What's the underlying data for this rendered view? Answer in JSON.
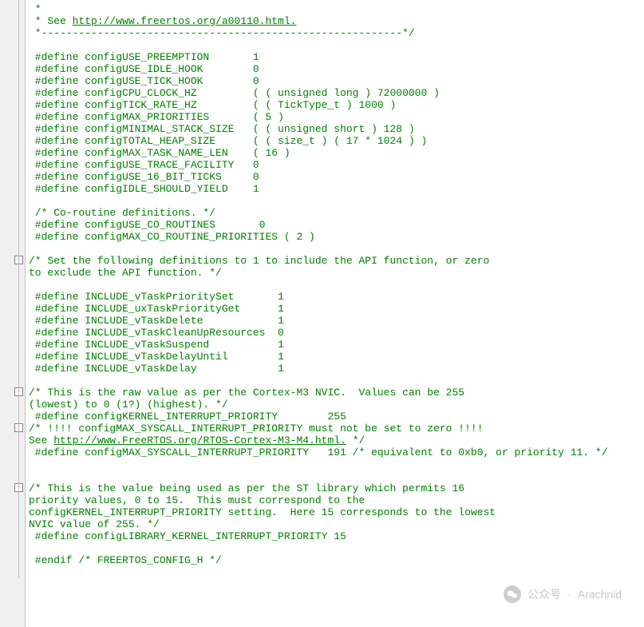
{
  "lines": [
    {
      "indent": " *",
      "text": ""
    },
    {
      "indent": " * See ",
      "link": "http://www.freertos.org/a00110.html.",
      "after": ""
    },
    {
      "indent": " *----------------------------------------------------------*/",
      "text": ""
    },
    {
      "indent": "",
      "text": ""
    },
    {
      "indent": " #define configUSE_PREEMPTION       1",
      "text": ""
    },
    {
      "indent": " #define configUSE_IDLE_HOOK        0",
      "text": ""
    },
    {
      "indent": " #define configUSE_TICK_HOOK        0",
      "text": ""
    },
    {
      "indent": " #define configCPU_CLOCK_HZ         ( ( unsigned long ) 72000000 )",
      "text": ""
    },
    {
      "indent": " #define configTICK_RATE_HZ         ( ( TickType_t ) 1000 )",
      "text": ""
    },
    {
      "indent": " #define configMAX_PRIORITIES       ( 5 )",
      "text": ""
    },
    {
      "indent": " #define configMINIMAL_STACK_SIZE   ( ( unsigned short ) 128 )",
      "text": ""
    },
    {
      "indent": " #define configTOTAL_HEAP_SIZE      ( ( size_t ) ( 17 * 1024 ) )",
      "text": ""
    },
    {
      "indent": " #define configMAX_TASK_NAME_LEN    ( 16 )",
      "text": ""
    },
    {
      "indent": " #define configUSE_TRACE_FACILITY   0",
      "text": ""
    },
    {
      "indent": " #define configUSE_16_BIT_TICKS     0",
      "text": ""
    },
    {
      "indent": " #define configIDLE_SHOULD_YIELD    1",
      "text": ""
    },
    {
      "indent": "",
      "text": ""
    },
    {
      "indent": " /* Co-routine definitions. */",
      "text": ""
    },
    {
      "indent": " #define configUSE_CO_ROUTINES       0",
      "text": ""
    },
    {
      "indent": " #define configMAX_CO_ROUTINE_PRIORITIES ( 2 )",
      "text": ""
    },
    {
      "indent": "",
      "text": ""
    },
    {
      "indent": "/* Set the following definitions to 1 to include the API function, or zero",
      "text": ""
    },
    {
      "indent": "to exclude the API function. */",
      "text": ""
    },
    {
      "indent": "",
      "text": ""
    },
    {
      "indent": " #define INCLUDE_vTaskPrioritySet       1",
      "text": ""
    },
    {
      "indent": " #define INCLUDE_uxTaskPriorityGet      1",
      "text": ""
    },
    {
      "indent": " #define INCLUDE_vTaskDelete            1",
      "text": ""
    },
    {
      "indent": " #define INCLUDE_vTaskCleanUpResources  0",
      "text": ""
    },
    {
      "indent": " #define INCLUDE_vTaskSuspend           1",
      "text": ""
    },
    {
      "indent": " #define INCLUDE_vTaskDelayUntil        1",
      "text": ""
    },
    {
      "indent": " #define INCLUDE_vTaskDelay             1",
      "text": ""
    },
    {
      "indent": "",
      "text": ""
    },
    {
      "indent": "/* This is the raw value as per the Cortex-M3 NVIC.  Values can be 255",
      "text": ""
    },
    {
      "indent": "(lowest) to 0 (1?) (highest). */",
      "text": ""
    },
    {
      "indent": " #define configKERNEL_INTERRUPT_PRIORITY        255",
      "text": ""
    },
    {
      "indent": "/* !!!! configMAX_SYSCALL_INTERRUPT_PRIORITY must not be set to zero !!!!",
      "text": ""
    },
    {
      "indent": "See ",
      "link": "http://www.FreeRTOS.org/RTOS-Cortex-M3-M4.html.",
      "after": " */"
    },
    {
      "indent": " #define configMAX_SYSCALL_INTERRUPT_PRIORITY   191 /* equivalent to 0xb0, or priority 11. */",
      "text": ""
    },
    {
      "indent": "",
      "text": ""
    },
    {
      "indent": "",
      "text": ""
    },
    {
      "indent": "/* This is the value being used as per the ST library which permits 16",
      "text": ""
    },
    {
      "indent": "priority values, 0 to 15.  This must correspond to the",
      "text": ""
    },
    {
      "indent": "configKERNEL_INTERRUPT_PRIORITY setting.  Here 15 corresponds to the lowest",
      "text": ""
    },
    {
      "indent": "NVIC value of 255. */",
      "text": ""
    },
    {
      "indent": " #define configLIBRARY_KERNEL_INTERRUPT_PRIORITY 15",
      "text": ""
    },
    {
      "indent": "",
      "text": ""
    },
    {
      "indent": " #endif /* FREERTOS_CONFIG_H */",
      "text": ""
    },
    {
      "indent": "",
      "text": ""
    }
  ],
  "fold_markers": [
    {
      "line": 21,
      "sym": "-"
    },
    {
      "line": 32,
      "sym": "-"
    },
    {
      "line": 35,
      "sym": "-"
    },
    {
      "line": 40,
      "sym": "-"
    }
  ],
  "watermark": {
    "label": "公众号",
    "sep": "·",
    "name": "Arachnid"
  }
}
